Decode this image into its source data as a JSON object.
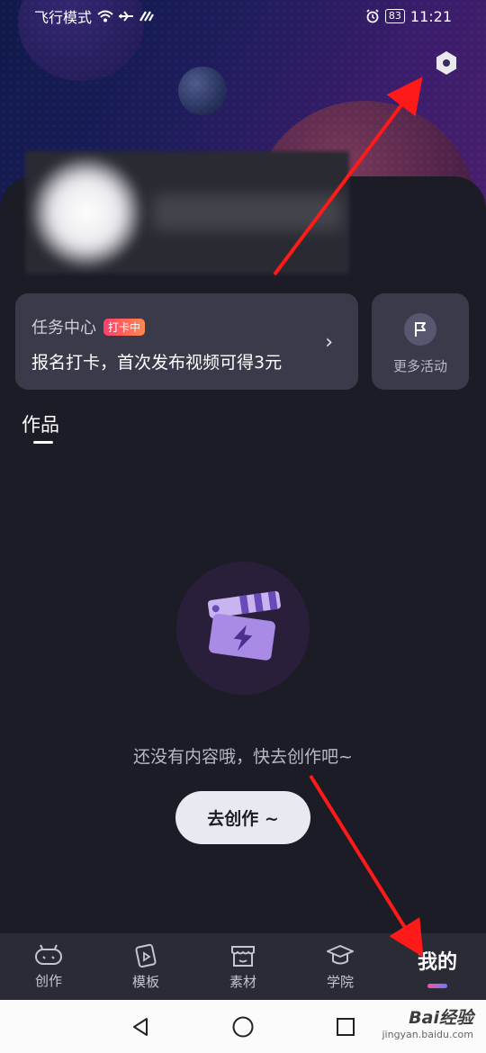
{
  "status_bar": {
    "mode": "飞行模式",
    "battery": "83",
    "time": "11:21"
  },
  "settings": {
    "icon": "settings-icon"
  },
  "task_card": {
    "title": "任务中心",
    "badge": "打卡中",
    "description": "报名打卡，首次发布视频可得3元"
  },
  "more_activities": {
    "label": "更多活动",
    "icon": "flag-icon"
  },
  "tabs": {
    "works": "作品"
  },
  "empty_state": {
    "message": "还没有内容哦，快去创作吧~",
    "button": "去创作 ~"
  },
  "bottom_nav": [
    {
      "label": "创作",
      "icon": "create-icon"
    },
    {
      "label": "模板",
      "icon": "template-icon"
    },
    {
      "label": "素材",
      "icon": "material-icon"
    },
    {
      "label": "学院",
      "icon": "academy-icon"
    },
    {
      "label": "我的",
      "icon": "profile",
      "active": true
    }
  ],
  "watermark": {
    "main": "Bai经验",
    "sub": "jingyan.baidu.com"
  },
  "colors": {
    "background": "#1c1c26",
    "card": "#3a3a4a",
    "badge_gradient": [
      "#ff3d6e",
      "#ff8a4a"
    ],
    "annotation": "#ff1a1a"
  }
}
